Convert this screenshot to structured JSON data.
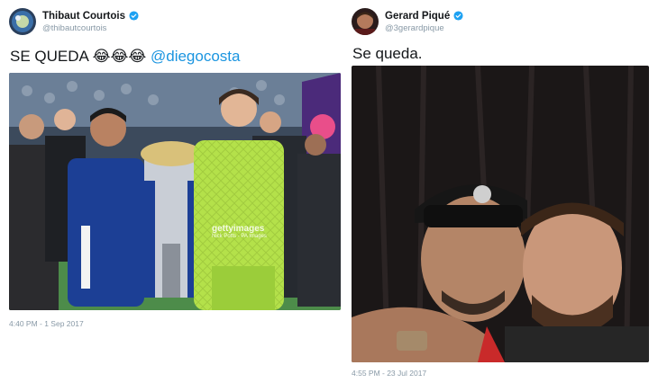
{
  "tweets": [
    {
      "name": "Thibaut Courtois",
      "handle": "@thibautcourtois",
      "text": "SE QUEDA",
      "emoji": "😂😂😂",
      "mention": "@diegocosta",
      "watermark": "gettyimages",
      "watermark_credit": "Nick Potts - PA Images",
      "timestamp": "4:40 PM - 1 Sep 2017"
    },
    {
      "name": "Gerard Piqué",
      "handle": "@3gerardpique",
      "text": "Se queda.",
      "timestamp": "4:55 PM - 23 Jul 2017"
    }
  ],
  "colors": {
    "link": "#1b95e0",
    "verified": "#1da1f2",
    "chelsea_blue": "#1c3f95",
    "keeper_green": "#b4e14a"
  },
  "icons": [
    "verified-badge-icon",
    "emoji-tears-of-joy-icon"
  ]
}
